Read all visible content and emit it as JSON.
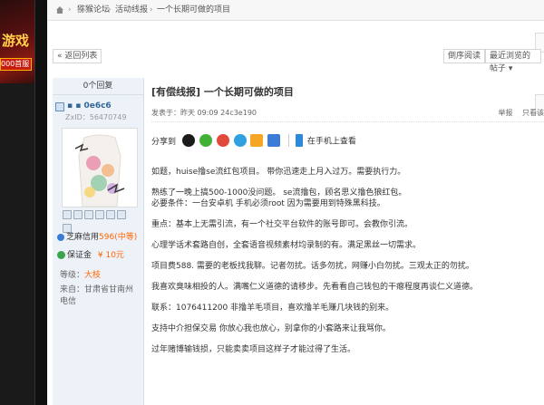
{
  "ad": {
    "banner_text": "游戏",
    "button_label": "000首服"
  },
  "breadcrumb": {
    "site": "猕猴论坛",
    "section": "活动线报",
    "page": "一个长期可做的项目"
  },
  "toolbar": {
    "back": "« 返回列表",
    "reverse": "倒序阅读",
    "sort": "最近浏览的帖子 ▾"
  },
  "author": {
    "replies": "0个回复",
    "name": "▪ ▪ 0e6c6",
    "zxid": "ZxID：56470749",
    "credit_label": "芝麻信用",
    "credit_value": "596(中等)",
    "deposit": "保证金",
    "deposit_value": "¥ 10元",
    "level_label": "等级：",
    "level_value": "大枝",
    "from": "来自：甘肃省甘南州 电信"
  },
  "post": {
    "title": "[有偿线报] 一个长期可做的项目",
    "meta": "发表于：昨天 09:09  24c3e190",
    "report": "举报",
    "only_author": "只看该",
    "share_label": "分享到",
    "view_on_mobile": "在手机上查看",
    "paragraphs": [
      [
        "如题，huise撸se流红包项目。 带你迅速走上月入过万。需要执行力。"
      ],
      [
        "熟练了一晚上搞500-1000没问题。 se流撸包，顾名思义撸色狼红包。",
        "必要条件：一台安卓机 手机必须root 因为需要用到特殊黑科技。"
      ],
      [
        "重点：基本上无需引流，有一个社交平台软件的账号即可。会教你引流。"
      ],
      [
        "心理学话术套路自创，全套语音视频素材均录制的有。满足黑丝一切需求。"
      ],
      [
        "项目费588. 需要的老板找我聊。记者勿扰。话多勿扰，网赚小白勿扰。三观太正的勿扰。"
      ],
      [
        "我喜欢臭味相投的人。满嘴仁义道德的请移步。先看看自己钱包的干瘪程度再谈仁义道德。"
      ],
      [
        "联系：1076411200 非撸羊毛项目，喜欢撸羊毛赚几块钱的别来。"
      ],
      [
        "支持中介担保交易 你放心我也放心，别拿你的小套路来让我骂你。"
      ],
      [
        "过年赌博输钱损，只能卖卖项目这样子才能过得了生活。"
      ]
    ]
  },
  "colors": {
    "link": "#336699",
    "credit": "#ff6600",
    "level": "#ff6600"
  }
}
